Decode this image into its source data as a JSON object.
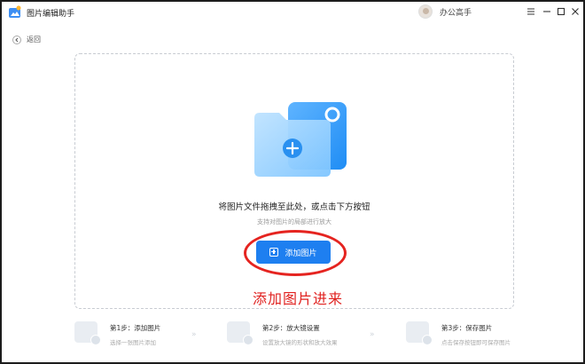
{
  "app": {
    "title": "图片编辑助手",
    "username": "办公高手"
  },
  "nav": {
    "back_label": "返回"
  },
  "dropzone": {
    "hint_main": "将图片文件拖拽至此处，或点击下方按钮",
    "hint_sub": "支持对图片的局部进行放大",
    "add_button_label": "添加图片"
  },
  "annotation": {
    "text": "添加图片进来",
    "color": "#e0211f"
  },
  "steps": [
    {
      "title": "第1步：添加图片",
      "desc": "选择一张图片添加"
    },
    {
      "title": "第2步：放大镜设置",
      "desc": "设置放大镜的形状和放大效果"
    },
    {
      "title": "第3步：保存图片",
      "desc": "点击保存按钮即可保存图片"
    }
  ],
  "colors": {
    "accent": "#1e7ff0",
    "annotation_red": "#e52420"
  }
}
